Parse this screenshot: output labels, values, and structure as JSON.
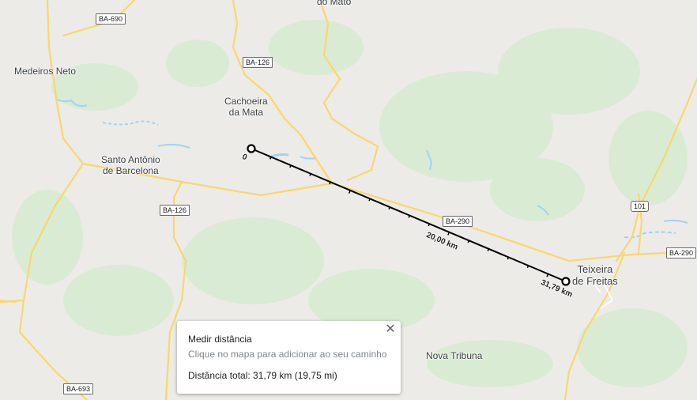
{
  "places": {
    "top_cut": "do Mato",
    "medeiros_neto": "Medeiros Neto",
    "cachoeira_1": "Cachoeira",
    "cachoeira_2": "da Mata",
    "santo_antonio_1": "Santo Antônio",
    "santo_antonio_2": "de Barcelona",
    "teixeira_1": "Teixeira",
    "teixeira_2": "de Freitas",
    "nova_tribuna": "Nova Tribuna"
  },
  "roads": {
    "ba690": "BA-690",
    "ba126_top": "BA-126",
    "ba126_mid": "BA-126",
    "ba290_mid": "BA-290",
    "ba290_right": "BA-290",
    "br101": "101",
    "ba693": "BA-693"
  },
  "measure": {
    "start_label": "0",
    "mid_label": "20,00 km",
    "end_label": "31,79 km"
  },
  "panel": {
    "title": "Medir distância",
    "hint": "Clique no mapa para adicionar ao seu caminho",
    "total": "Distância total: 31,79 km (19,75 mi)",
    "close_symbol": "✕"
  },
  "colors": {
    "background": "#ecebe7",
    "vegetation": "#d4ead0",
    "road": "#f9d76b",
    "water": "#9fd3f5",
    "measure_line": "#000000"
  }
}
